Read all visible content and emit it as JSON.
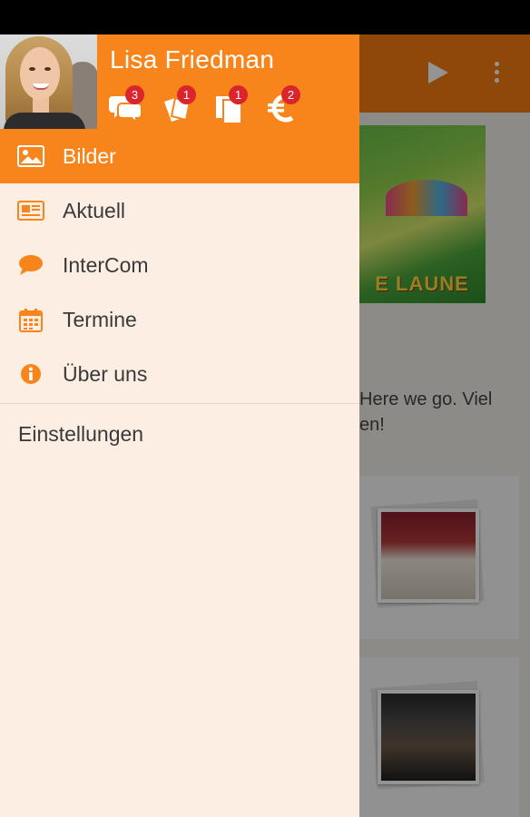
{
  "drawer": {
    "user_name": "Lisa Friedman",
    "header_icons": [
      {
        "name": "chat-bubbles-icon",
        "badge": "3"
      },
      {
        "name": "tickets-icon",
        "badge": "1"
      },
      {
        "name": "documents-icon",
        "badge": "1"
      },
      {
        "name": "euro-icon",
        "badge": "2"
      }
    ],
    "menu": [
      {
        "label": "Bilder",
        "icon": "image-icon",
        "active": true
      },
      {
        "label": "Aktuell",
        "icon": "newspaper-icon",
        "active": false
      },
      {
        "label": "InterCom",
        "icon": "chat-bubble-icon",
        "active": false
      },
      {
        "label": "Termine",
        "icon": "calendar-icon",
        "active": false
      },
      {
        "label": "Über uns",
        "icon": "info-icon",
        "active": false
      }
    ],
    "settings_label": "Einstellungen"
  },
  "background": {
    "poster_text": "E LAUNE",
    "post_text": "Here we go. Viel\nen!"
  },
  "colors": {
    "accent": "#f7851b",
    "drawer_bg": "#fdeee4",
    "badge": "#d9252b"
  }
}
